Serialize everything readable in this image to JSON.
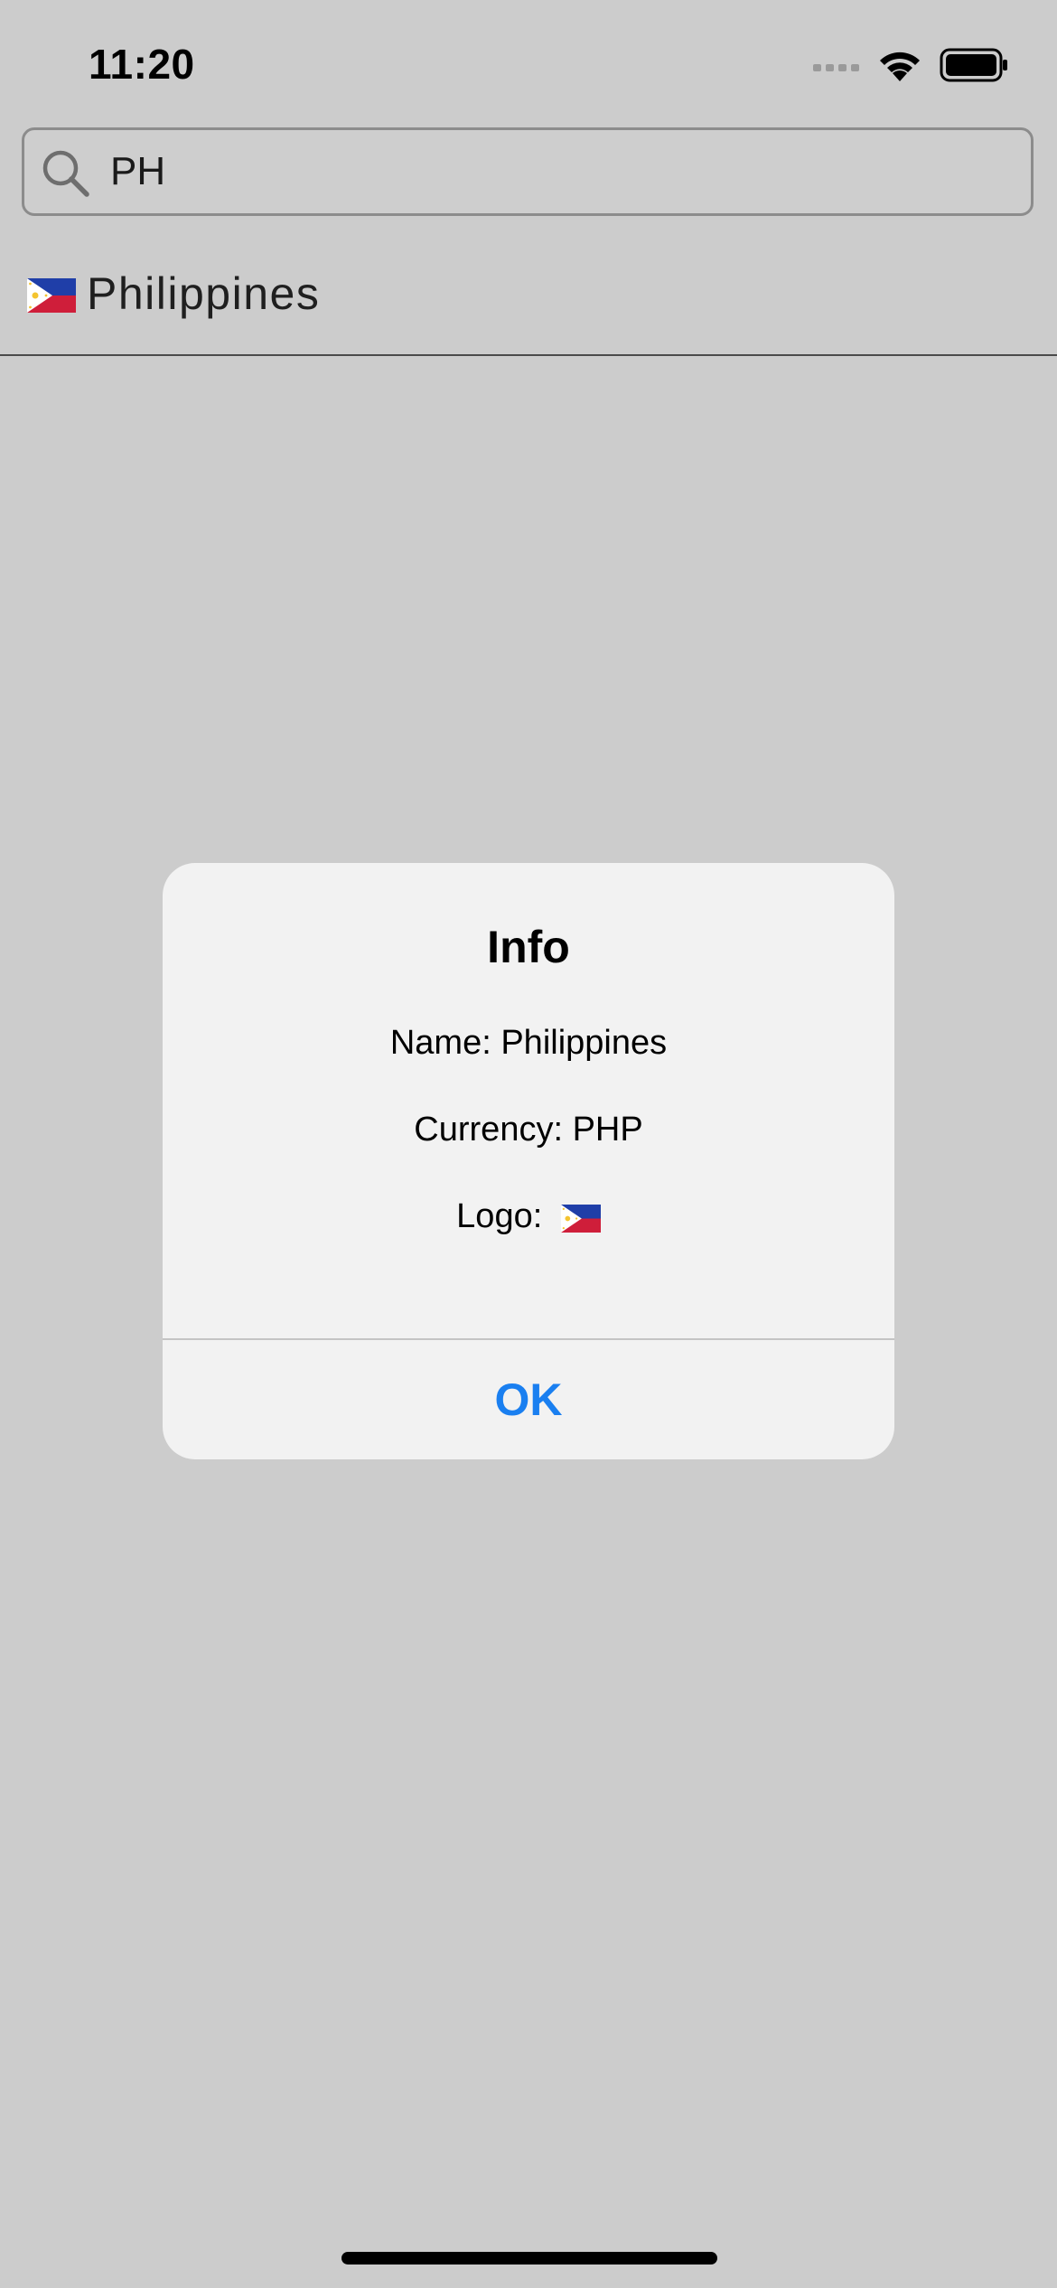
{
  "status_bar": {
    "time": "11:20",
    "signal_icon": "cellular-signal-icon",
    "wifi_icon": "wifi-icon",
    "battery_icon": "battery-icon"
  },
  "search": {
    "value": "PH",
    "icon": "search-icon"
  },
  "results": [
    {
      "flag_icon": "philippines-flag-icon",
      "label": "Philippines"
    }
  ],
  "alert": {
    "title": "Info",
    "name_line": "Name: Philippines",
    "currency_line": "Currency: PHP",
    "logo_label": "Logo:",
    "logo_icon": "philippines-flag-icon",
    "ok_label": "OK",
    "accent_color": "#1a7ff0"
  }
}
